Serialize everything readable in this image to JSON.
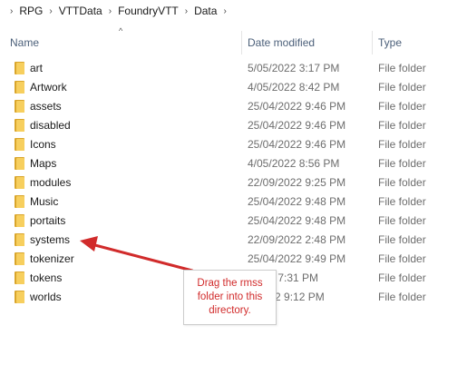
{
  "breadcrumb": {
    "items": [
      "RPG",
      "VTTData",
      "FoundryVTT",
      "Data"
    ],
    "separator": "›"
  },
  "columns": {
    "name": "Name",
    "date_modified": "Date modified",
    "type": "Type",
    "sort_indicator": "^"
  },
  "rows": [
    {
      "name": "art",
      "date": "5/05/2022 3:17 PM",
      "type": "File folder"
    },
    {
      "name": "Artwork",
      "date": "4/05/2022 8:42 PM",
      "type": "File folder"
    },
    {
      "name": "assets",
      "date": "25/04/2022 9:46 PM",
      "type": "File folder"
    },
    {
      "name": "disabled",
      "date": "25/04/2022 9:46 PM",
      "type": "File folder"
    },
    {
      "name": "Icons",
      "date": "25/04/2022 9:46 PM",
      "type": "File folder"
    },
    {
      "name": "Maps",
      "date": "4/05/2022 8:56 PM",
      "type": "File folder"
    },
    {
      "name": "modules",
      "date": "22/09/2022 9:25 PM",
      "type": "File folder"
    },
    {
      "name": "Music",
      "date": "25/04/2022 9:48 PM",
      "type": "File folder"
    },
    {
      "name": "portaits",
      "date": "25/04/2022 9:48 PM",
      "type": "File folder"
    },
    {
      "name": "systems",
      "date": "22/09/2022 2:48 PM",
      "type": "File folder"
    },
    {
      "name": "tokenizer",
      "date": "25/04/2022 9:49 PM",
      "type": "File folder"
    },
    {
      "name": "tokens",
      "date": "/2022 7:31 PM",
      "type": "File folder"
    },
    {
      "name": "worlds",
      "date": "9/2022 9:12 PM",
      "type": "File folder"
    }
  ],
  "callout": {
    "lines": [
      "Drag the rmss",
      "folder into this",
      "directory."
    ],
    "color": "#d12b2b"
  },
  "colors": {
    "folder": "#f7cf5e",
    "header_text": "#4c607a",
    "annotation": "#d12b2b"
  }
}
